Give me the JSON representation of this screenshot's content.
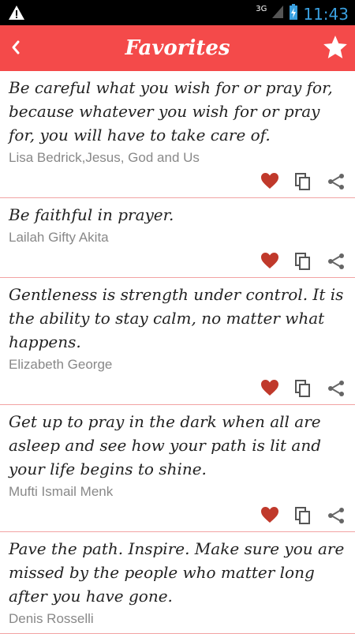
{
  "statusbar": {
    "network": "3G",
    "time": "11:43"
  },
  "appbar": {
    "title": "Favorites"
  },
  "quotes": [
    {
      "text": "Be careful what you wish for or pray for, because whatever you wish for or pray for, you will have to take care of.",
      "author": "Lisa Bedrick,Jesus, God and Us"
    },
    {
      "text": "Be faithful in prayer.",
      "author": "Lailah Gifty Akita"
    },
    {
      "text": "Gentleness is strength under control. It is the ability to stay calm, no matter what happens.",
      "author": "Elizabeth George"
    },
    {
      "text": "Get up to pray in the dark when all are asleep and see how your path is lit and your life begins to shine.",
      "author": "Mufti Ismail Menk"
    },
    {
      "text": "Pave the path. Inspire. Make sure you are missed by the people who matter long after you have gone.",
      "author": "Denis Rosselli"
    }
  ],
  "colors": {
    "accent": "#f44a4a",
    "heart": "#c0392b",
    "divider": "#f2a3a3"
  }
}
